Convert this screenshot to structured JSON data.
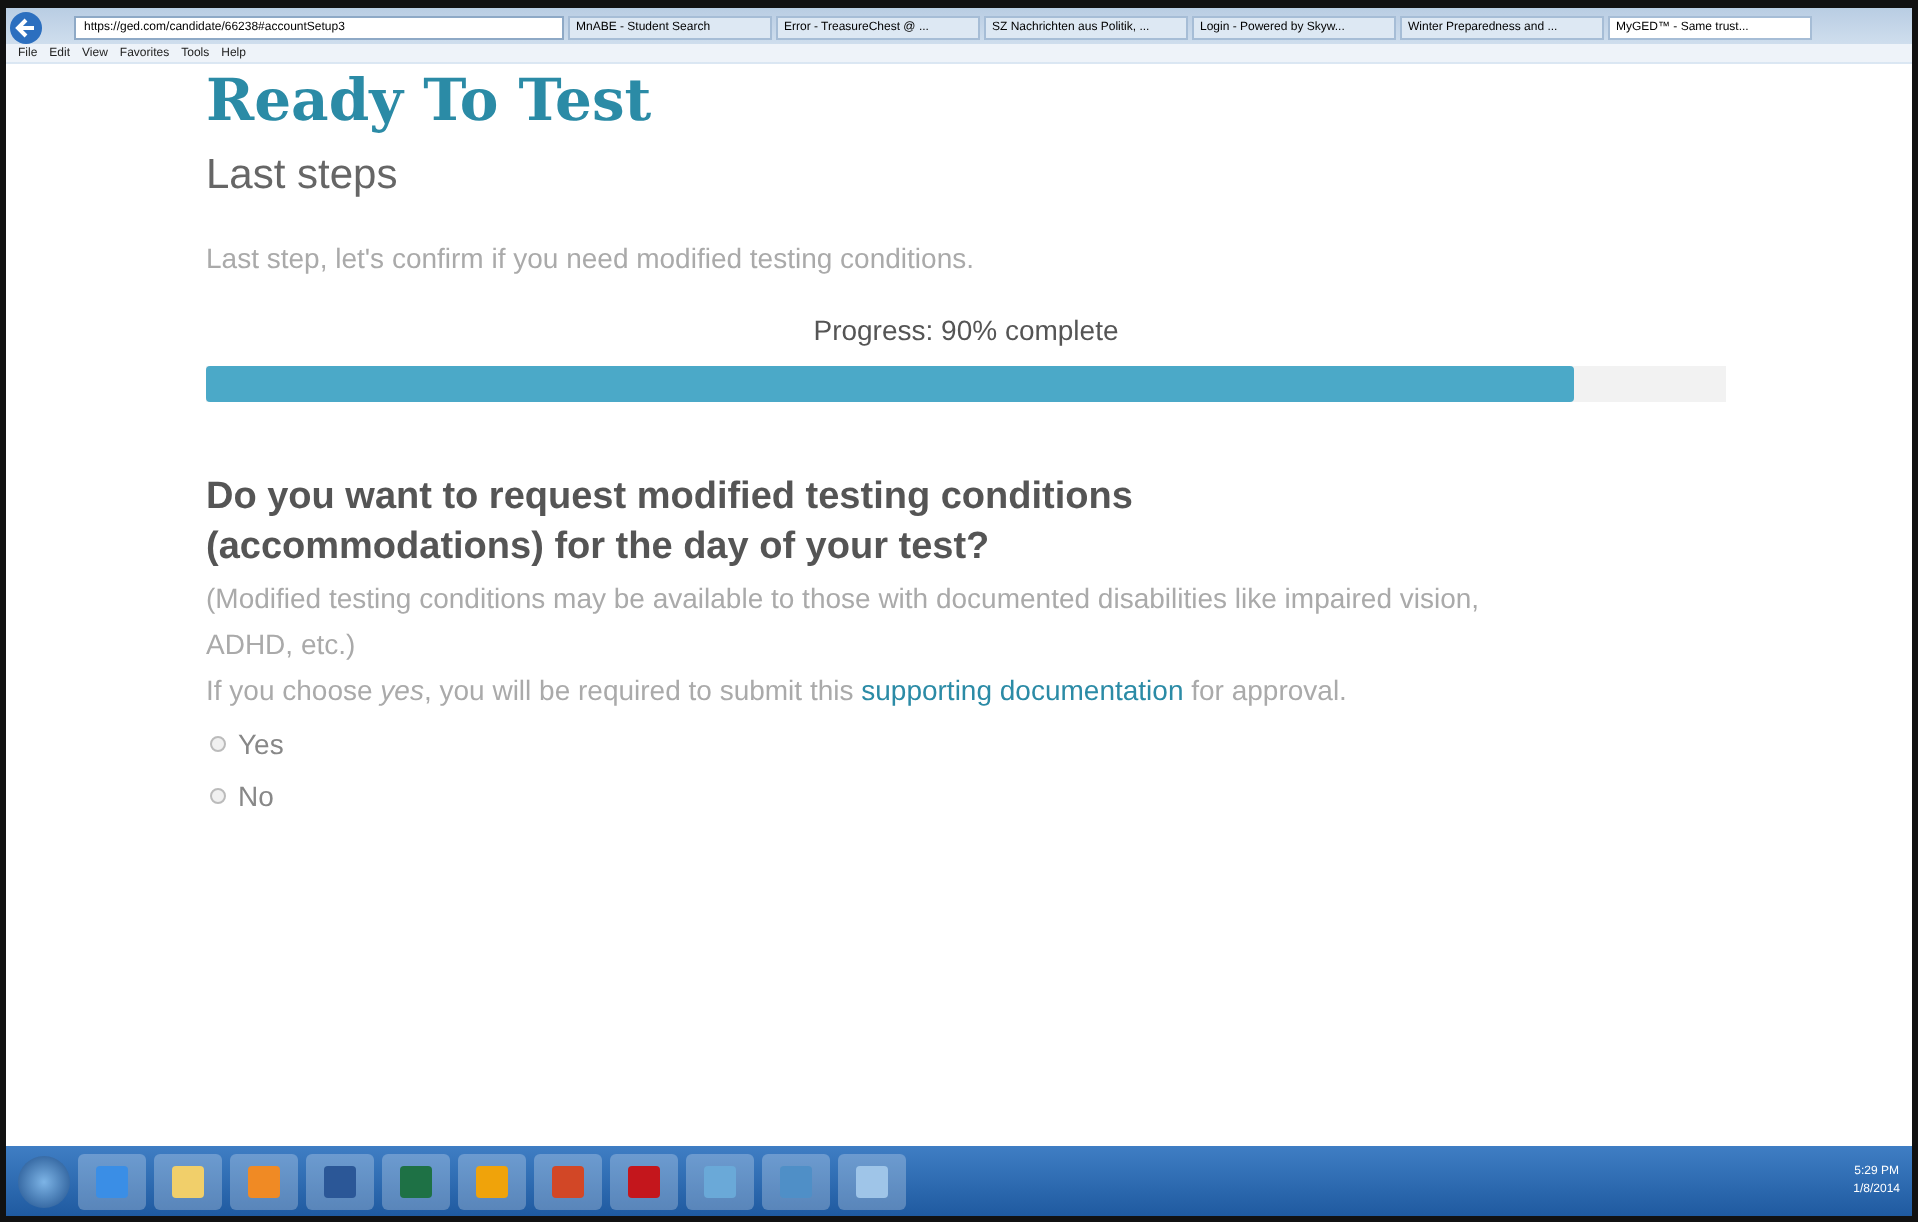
{
  "browser": {
    "url": "https://ged.com/candidate/66238#accountSetup3",
    "tabs": [
      {
        "label": "MnABE - Student Search",
        "selected": false
      },
      {
        "label": "Error - TreasureChest @ ...",
        "selected": false
      },
      {
        "label": "SZ Nachrichten aus Politik, ...",
        "selected": false
      },
      {
        "label": "Login - Powered by Skyw...",
        "selected": false
      },
      {
        "label": "Winter Preparedness and ...",
        "selected": false
      },
      {
        "label": "MyGED™ - Same trust...",
        "selected": true
      }
    ],
    "menu": [
      "File",
      "Edit",
      "View",
      "Favorites",
      "Tools",
      "Help"
    ]
  },
  "page": {
    "title": "Ready To Test",
    "subtitle": "Last steps",
    "intro": "Last step, let's confirm if you need modified testing conditions.",
    "progress": {
      "label": "Progress: 90% complete",
      "level": 0.9
    },
    "question": "Do you want to request modified testing conditions (accommodations) for the day of your test?",
    "note": "(Modified testing conditions may be available to those with documented disabilities like impaired vision, ADHD, etc.)",
    "info_before": "If you choose *yes*, you will be required to submit this",
    "info_link": "supporting documentation",
    "info_after": "for approval.",
    "options": [
      {
        "label": "Yes",
        "selected": false
      },
      {
        "label": "No",
        "selected": false
      }
    ]
  },
  "taskbar": {
    "time": "5:29 PM",
    "date": "1/8/2014"
  }
}
